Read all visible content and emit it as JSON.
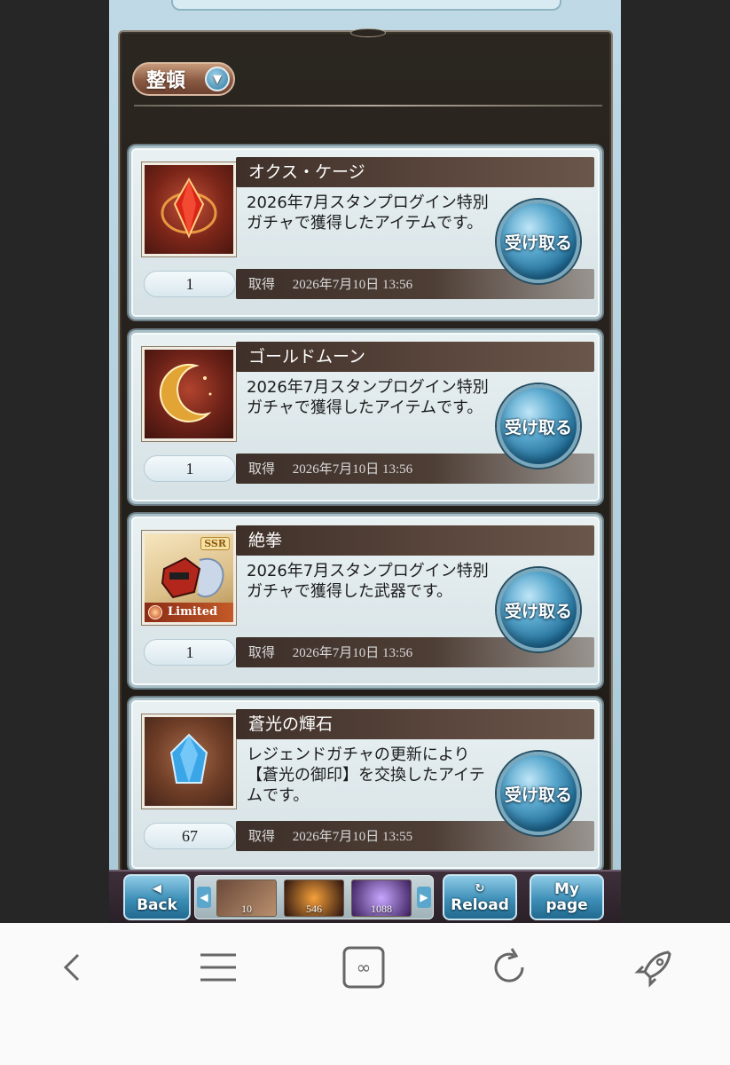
{
  "toolbar": {
    "sort_label": "整頓"
  },
  "items": [
    {
      "name": "オクス・ケージ",
      "description": "2026年7月スタンプログイン特別ガチャで獲得したアイテムです。",
      "quantity": "1",
      "acquired_label": "取得",
      "acquired_date": "2026年7月10日 13:56",
      "receive_label": "受け取る"
    },
    {
      "name": "ゴールドムーン",
      "description": "2026年7月スタンプログイン特別ガチャで獲得したアイテムです。",
      "quantity": "1",
      "acquired_label": "取得",
      "acquired_date": "2026年7月10日 13:56",
      "receive_label": "受け取る"
    },
    {
      "name": "絶拳",
      "description": "2026年7月スタンプログイン特別ガチャで獲得した武器です。",
      "quantity": "1",
      "acquired_label": "取得",
      "acquired_date": "2026年7月10日 13:56",
      "receive_label": "受け取る",
      "rarity_badge": "SSR",
      "limited_label": "Limited"
    },
    {
      "name": "蒼光の輝石",
      "description": "レジェンドガチャの更新により【蒼光の御印】を交換したアイテムです。",
      "quantity": "67",
      "acquired_label": "取得",
      "acquired_date": "2026年7月10日 13:55",
      "receive_label": "受け取る"
    }
  ],
  "bottom_nav": {
    "back_label": "Back",
    "reload_label": "Reload",
    "mypage_line1": "My",
    "mypage_line2": "page",
    "strip_counts": [
      "10",
      "546",
      "1088"
    ]
  },
  "browser_icons": [
    "back-arrow-icon",
    "menu-icon",
    "tabs-icon",
    "refresh-icon",
    "rocket-icon"
  ],
  "colors": {
    "receive_button": "#2f86b4",
    "title_bar": "#4a3a32",
    "card_bg": "#e3edf0"
  }
}
